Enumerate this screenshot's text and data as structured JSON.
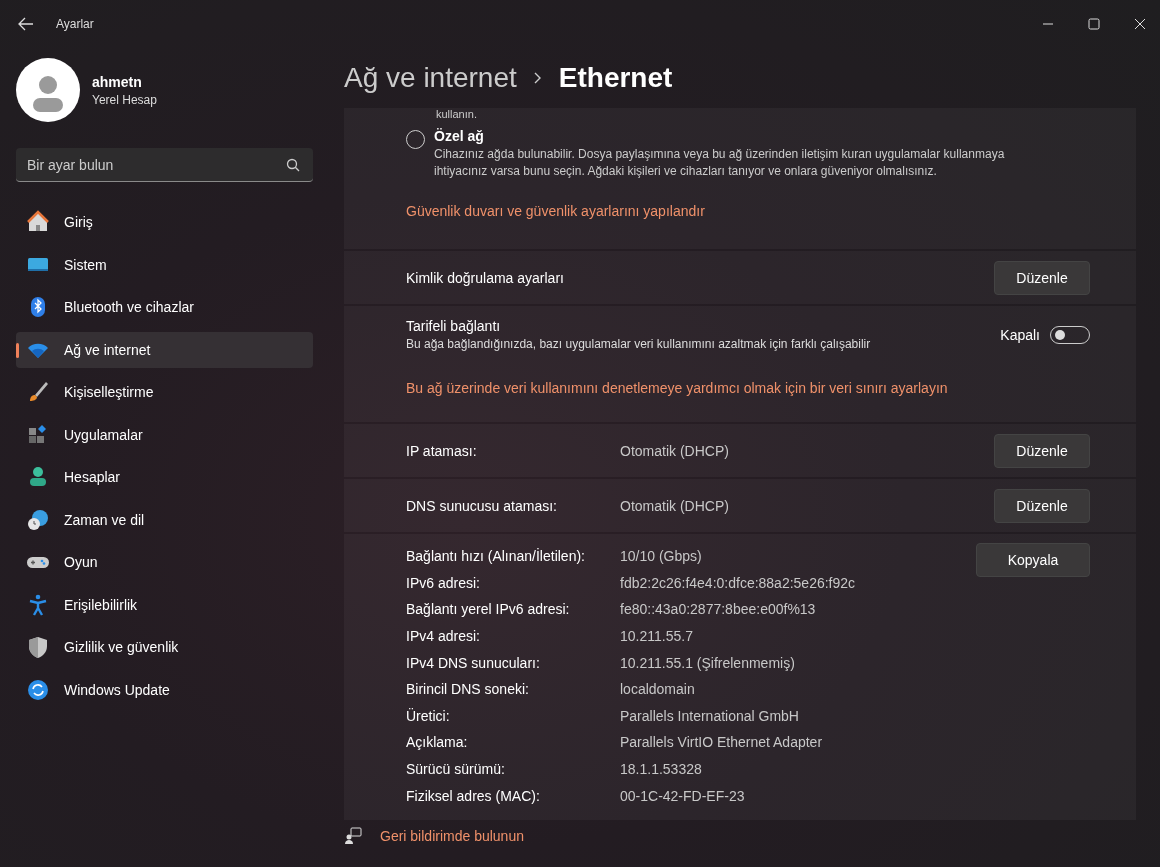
{
  "window": {
    "title": "Ayarlar"
  },
  "profile": {
    "name": "ahmetn",
    "account_type": "Yerel Hesap"
  },
  "search": {
    "placeholder": "Bir ayar bulun"
  },
  "sidebar": {
    "items": [
      {
        "label": "Giriş",
        "selected": false
      },
      {
        "label": "Sistem",
        "selected": false
      },
      {
        "label": "Bluetooth ve cihazlar",
        "selected": false
      },
      {
        "label": "Ağ ve internet",
        "selected": true
      },
      {
        "label": "Kişiselleştirme",
        "selected": false
      },
      {
        "label": "Uygulamalar",
        "selected": false
      },
      {
        "label": "Hesaplar",
        "selected": false
      },
      {
        "label": "Zaman ve dil",
        "selected": false
      },
      {
        "label": "Oyun",
        "selected": false
      },
      {
        "label": "Erişilebilirlik",
        "selected": false
      },
      {
        "label": "Gizlilik ve güvenlik",
        "selected": false
      },
      {
        "label": "Windows Update",
        "selected": false
      }
    ]
  },
  "breadcrumb": {
    "parent": "Ağ ve internet",
    "current": "Ethernet"
  },
  "network_profile": {
    "truncated_text": "kullanın.",
    "option": {
      "label": "Özel ağ",
      "selected": false,
      "description": "Cihazınız ağda bulunabilir. Dosya paylaşımına veya bu ağ üzerinden iletişim kuran uygulamalar kullanmaya ihtiyacınız varsa bunu seçin. Ağdaki kişileri ve cihazları tanıyor ve onlara güveniyor olmalısınız."
    },
    "link": "Güvenlik duvarı ve güvenlik ayarlarını yapılandır"
  },
  "authentication": {
    "label": "Kimlik doğrulama ayarları",
    "button": "Düzenle"
  },
  "metered": {
    "label": "Tarifeli bağlantı",
    "description": "Bu ağa bağlandığınızda, bazı uygulamalar veri kullanımını azaltmak için farklı çalışabilir",
    "state_label": "Kapalı",
    "on": false,
    "link": "Bu ağ üzerinde veri kullanımını denetlemeye yardımcı olmak için bir veri sınırı ayarlayın"
  },
  "ip_settings": [
    {
      "label": "IP ataması:",
      "value": "Otomatik (DHCP)",
      "button": "Düzenle"
    },
    {
      "label": "DNS sunucusu ataması:",
      "value": "Otomatik (DHCP)",
      "button": "Düzenle"
    }
  ],
  "properties": {
    "button": "Kopyala",
    "rows": [
      {
        "label": "Bağlantı hızı (Alınan/İletilen):",
        "value": "10/10 (Gbps)"
      },
      {
        "label": "IPv6 adresi:",
        "value": "fdb2:2c26:f4e4:0:dfce:88a2:5e26:f92c"
      },
      {
        "label": "Bağlantı yerel IPv6 adresi:",
        "value": "fe80::43a0:2877:8bee:e00f%13"
      },
      {
        "label": "IPv4 adresi:",
        "value": "10.211.55.7"
      },
      {
        "label": "IPv4 DNS sunucuları:",
        "value": "10.211.55.1 (Şifrelenmemiş)"
      },
      {
        "label": "Birincil DNS soneki:",
        "value": "localdomain"
      },
      {
        "label": "Üretici:",
        "value": "Parallels International GmbH"
      },
      {
        "label": "Açıklama:",
        "value": "Parallels VirtIO Ethernet Adapter"
      },
      {
        "label": "Sürücü sürümü:",
        "value": "18.1.1.53328"
      },
      {
        "label": "Fiziksel adres (MAC):",
        "value": "00-1C-42-FD-EF-23"
      }
    ]
  },
  "feedback": {
    "link": "Geri bildirimde bulunun"
  }
}
